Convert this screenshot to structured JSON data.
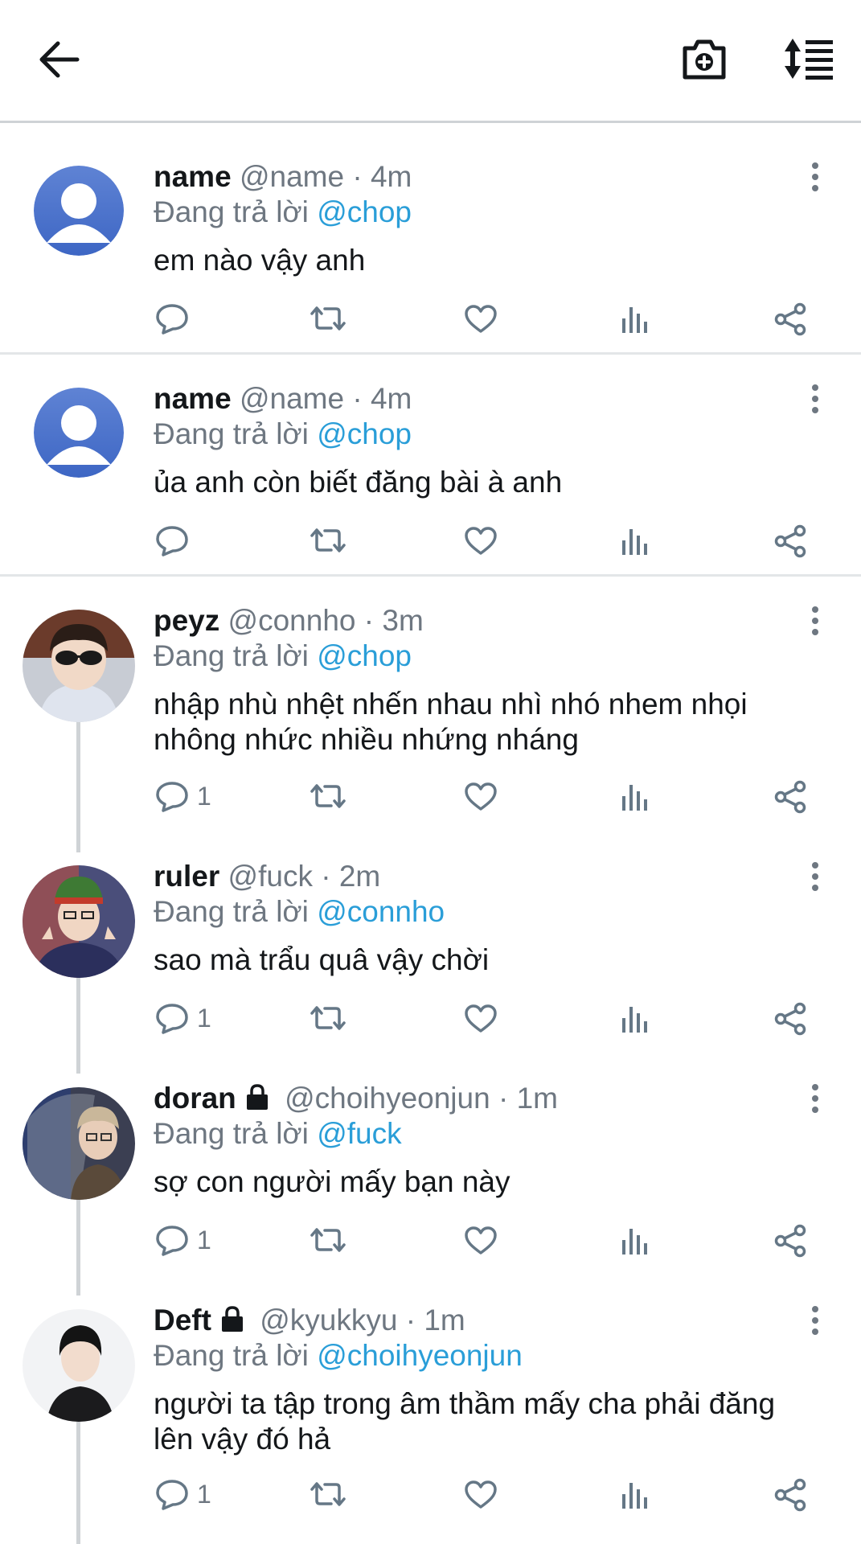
{
  "header": {
    "back_icon": "arrow-left-icon",
    "camera_icon": "camera-plus-icon",
    "sort_icon": "sort-list-icon"
  },
  "colors": {
    "text": "#14171a",
    "muted": "#6e7781",
    "accent": "#2a9ed8",
    "divider": "#e3e6e8"
  },
  "replies": [
    {
      "name": "name",
      "handle": "@name",
      "time": "· 4m",
      "locked": false,
      "reply_prefix": "Đang trả lời",
      "reply_to": "@chop",
      "text": "em nào vậy anh",
      "reply_count": "",
      "avatar": "default-avatar"
    },
    {
      "name": "name",
      "handle": "@name",
      "time": "· 4m",
      "locked": false,
      "reply_prefix": "Đang trả lời",
      "reply_to": "@chop",
      "text": "ủa anh còn biết đăng bài à anh",
      "reply_count": "",
      "avatar": "default-avatar"
    },
    {
      "name": "peyz",
      "handle": "@connho",
      "time": "· 3m",
      "locked": false,
      "reply_prefix": "Đang trả lời",
      "reply_to": "@chop",
      "text": "nhập nhù nhệt nhến nhau nhì nhó nhem nhọi nhông nhức nhiều nhứng nháng",
      "reply_count": "1",
      "avatar": "photo-avatar"
    },
    {
      "name": "ruler",
      "handle": "@fuck",
      "time": "· 2m",
      "locked": false,
      "reply_prefix": "Đang trả lời",
      "reply_to": "@connho",
      "text": "sao mà trẩu quâ vậy chời",
      "reply_count": "1",
      "avatar": "photo-avatar"
    },
    {
      "name": "doran",
      "handle": "@choihyeonjun",
      "time": "· 1m",
      "locked": true,
      "reply_prefix": "Đang trả lời",
      "reply_to": "@fuck",
      "text": "sợ con người mấy bạn này",
      "reply_count": "1",
      "avatar": "photo-avatar"
    },
    {
      "name": "Deft",
      "handle": "@kyukkyu",
      "time": "· 1m",
      "locked": true,
      "reply_prefix": "Đang trả lời",
      "reply_to": "@choihyeonjun",
      "text": "người ta tập trong âm thầm mấy cha phải đăng lên vậy đó hả",
      "reply_count": "1",
      "avatar": "photo-avatar"
    }
  ],
  "action_icons": [
    "reply-icon",
    "retweet-icon",
    "like-icon",
    "analytics-icon",
    "share-icon"
  ]
}
